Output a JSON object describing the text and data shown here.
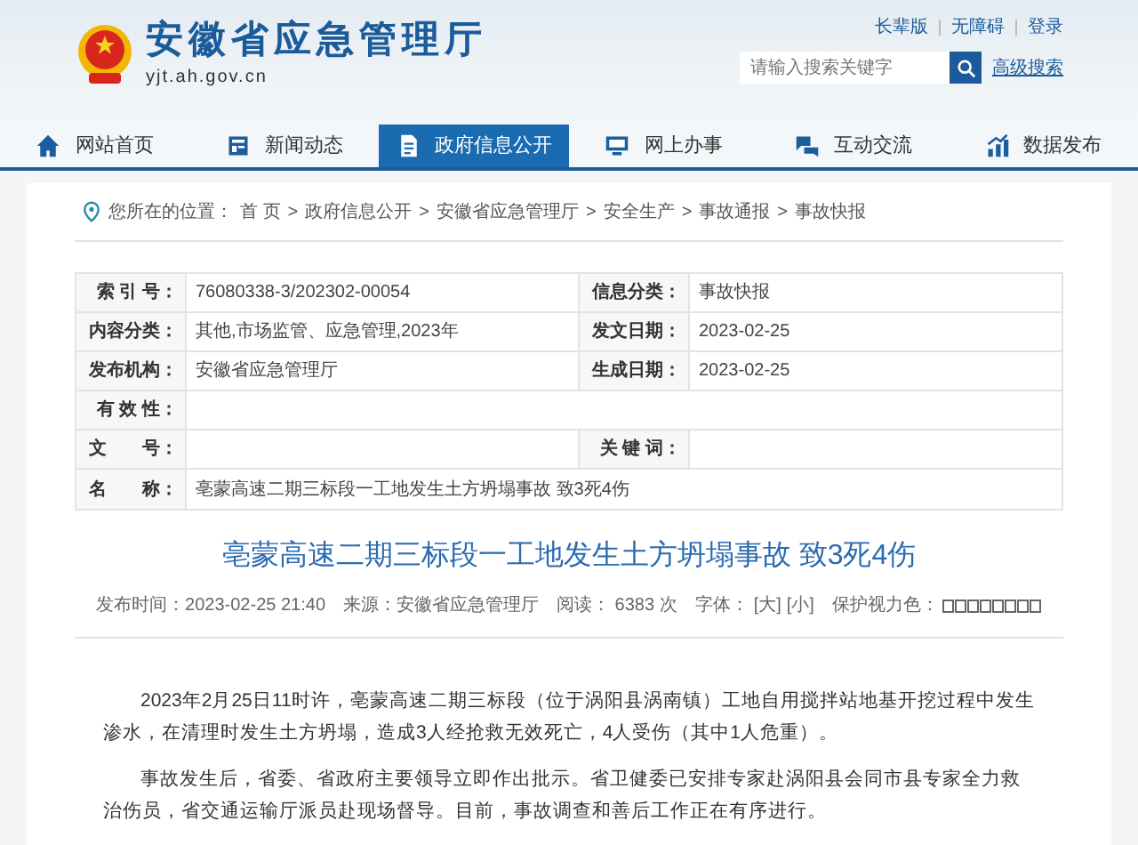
{
  "header": {
    "site_name": "安徽省应急管理厅",
    "domain": "yjt.ah.gov.cn",
    "top_links": [
      "长辈版",
      "无障碍",
      "登录"
    ],
    "search": {
      "placeholder": "请输入搜索关键字"
    },
    "advanced_search": "高级搜索"
  },
  "nav": [
    {
      "label": "网站首页",
      "selected": false
    },
    {
      "label": "新闻动态",
      "selected": false
    },
    {
      "label": "政府信息公开",
      "selected": true
    },
    {
      "label": "网上办事",
      "selected": false
    },
    {
      "label": "互动交流",
      "selected": false
    },
    {
      "label": "数据发布",
      "selected": false
    }
  ],
  "breadcrumb": {
    "prefix": "您所在的位置：",
    "separator": ">",
    "items": [
      "首 页",
      "政府信息公开",
      "安徽省应急管理厅",
      "安全生产",
      "事故通报",
      "事故快报"
    ]
  },
  "info_table": [
    [
      {
        "label": "索 引 号：",
        "value": "76080338-3/202302-00054"
      },
      {
        "label": "信息分类：",
        "value": "事故快报"
      }
    ],
    [
      {
        "label": "内容分类：",
        "value": "其他,市场监管、应急管理,2023年"
      },
      {
        "label": "发文日期：",
        "value": "2023-02-25"
      }
    ],
    [
      {
        "label": "发布机构：",
        "value": "安徽省应急管理厅"
      },
      {
        "label": "生成日期：",
        "value": "2023-02-25"
      }
    ],
    [
      {
        "label": "有 效 性："
      }
    ],
    [
      {
        "label": "文　　号："
      },
      {
        "label": "关 键 词："
      }
    ],
    [
      {
        "label": "名　　称：",
        "value": "亳蒙高速二期三标段一工地发生土方坍塌事故 致3死4伤"
      }
    ]
  ],
  "article": {
    "title": "亳蒙高速二期三标段一工地发生土方坍塌事故 致3死4伤",
    "meta": [
      {
        "kind": "text",
        "text": "发布时间：2023-02-25 21:40"
      },
      {
        "kind": "text",
        "text": "来源：安徽省应急管理厅"
      },
      {
        "kind": "text",
        "text": "阅读：  6383  次"
      },
      {
        "kind": "font",
        "text": "字体：",
        "options": [
          "[大]",
          "[小]"
        ]
      },
      {
        "kind": "colors",
        "text": "保护视力色："
      }
    ],
    "paragraphs": [
      "2023年2月25日11时许，亳蒙高速二期三标段（位于涡阳县涡南镇）工地自用搅拌站地基开挖过程中发生渗水，在清理时发生土方坍塌，造成3人经抢救无效死亡，4人受伤（其中1人危重）。",
      "事故发生后，省委、省政府主要领导立即作出批示。省卫健委已安排专家赴涡阳县会同市县专家全力救治伤员，省交通运输厅派员赴现场督导。目前，事故调查和善后工作正在有序进行。"
    ]
  }
}
